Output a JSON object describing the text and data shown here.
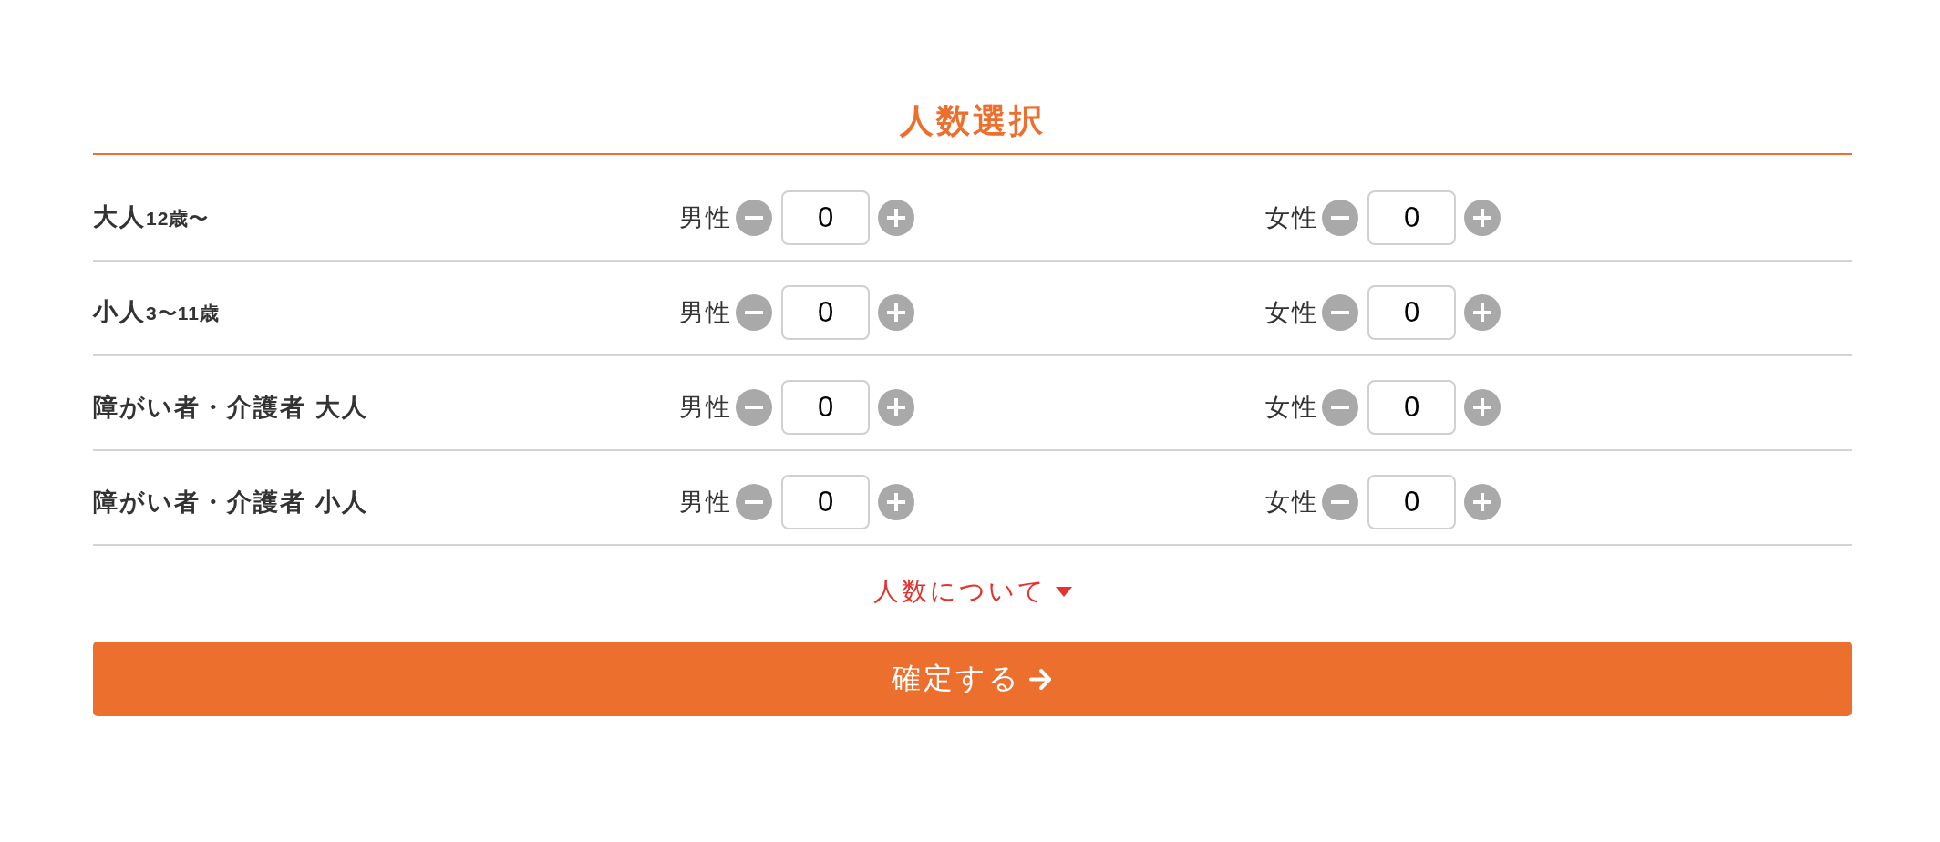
{
  "title": "人数選択",
  "rows": [
    {
      "label": "大人",
      "age": "12歳〜",
      "groups": [
        {
          "label": "男性",
          "value": "0"
        },
        {
          "label": "女性",
          "value": "0"
        }
      ]
    },
    {
      "label": "小人",
      "age": "3〜11歳",
      "groups": [
        {
          "label": "男性",
          "value": "0"
        },
        {
          "label": "女性",
          "value": "0"
        }
      ]
    },
    {
      "label": "障がい者・介護者 大人",
      "groups": [
        {
          "label": "男性",
          "value": "0"
        },
        {
          "label": "女性",
          "value": "0"
        }
      ]
    },
    {
      "label": "障がい者・介護者 小人",
      "groups": [
        {
          "label": "男性",
          "value": "0"
        },
        {
          "label": "女性",
          "value": "0"
        }
      ]
    }
  ],
  "info_link": {
    "label": "人数について",
    "expanded": false
  },
  "confirm_button": {
    "label": "確定する"
  }
}
